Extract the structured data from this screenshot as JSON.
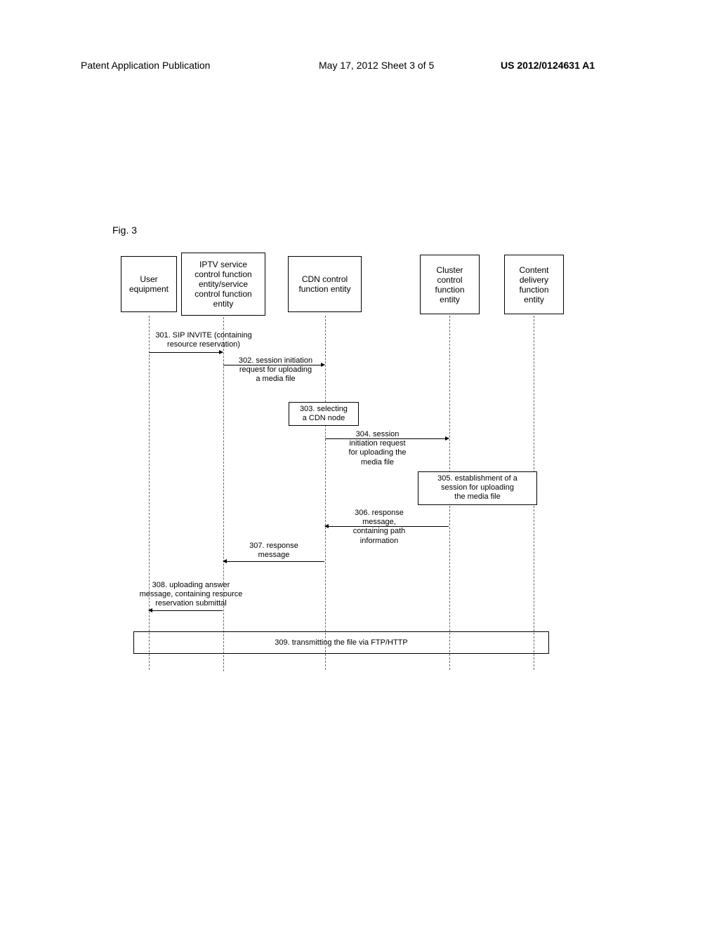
{
  "header": {
    "left": "Patent Application Publication",
    "center": "May 17, 2012  Sheet 3 of 5",
    "right": "US 2012/0124631 A1"
  },
  "figure_label": "Fig. 3",
  "entities": [
    {
      "id": "ue",
      "label": "User\nequipment"
    },
    {
      "id": "iptv",
      "label": "IPTV service\ncontrol function\nentity/service\ncontrol function\nentity"
    },
    {
      "id": "cdn",
      "label": "CDN control\nfunction entity"
    },
    {
      "id": "cluster",
      "label": "Cluster\ncontrol\nfunction\nentity"
    },
    {
      "id": "content",
      "label": "Content\ndelivery\nfunction\nentity"
    }
  ],
  "messages": {
    "m301": "301. SIP INVITE (containing\nresource reservation)",
    "m302": "302. session initiation\nrequest for uploading\na media file",
    "m303": "303. selecting\na CDN node",
    "m304": "304. session\ninitiation request\nfor uploading the\nmedia file",
    "m305": "305. establishment of a\nsession for uploading\nthe media file",
    "m306": "306. response\nmessage,\ncontaining path\ninformation",
    "m307": "307. response\nmessage",
    "m308": "308. uploading answer\nmessage, containing resource\nreservation submittal",
    "m309": "309. transmitting the file via FTP/HTTP"
  }
}
